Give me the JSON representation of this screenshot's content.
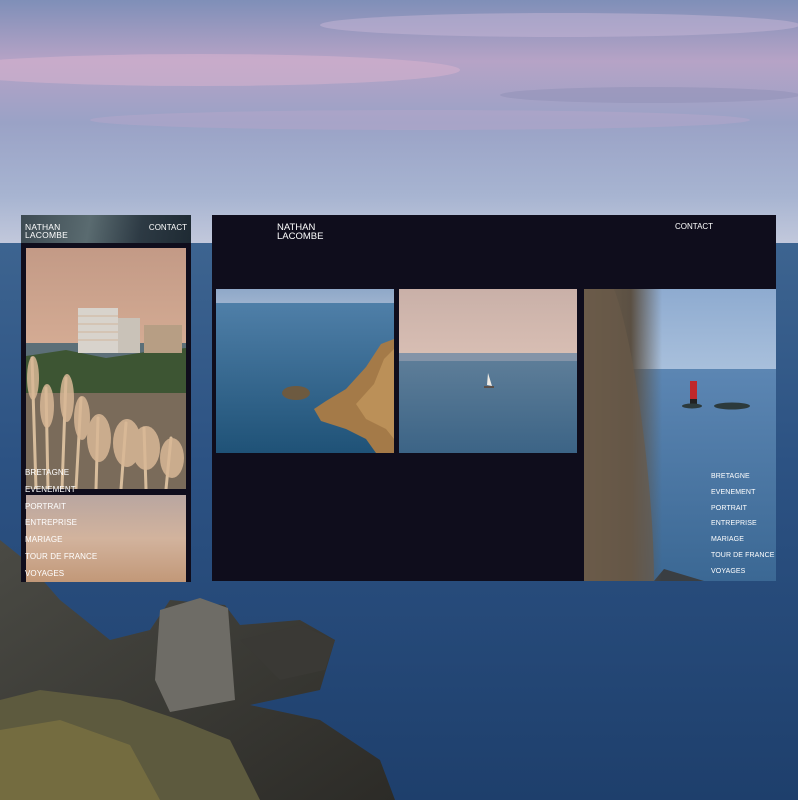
{
  "mobile": {
    "logo_line1": "NATHAN",
    "logo_line2": "LACOMBE",
    "contact": "CONTACT",
    "menu": [
      "BRETAGNE",
      "EVENEMENT",
      "PORTRAIT",
      "ENTREPRISE",
      "MARIAGE",
      "TOUR DE FRANCE",
      "VOYAGES"
    ]
  },
  "desktop": {
    "logo_line1": "NATHAN",
    "logo_line2": "LACOMBE",
    "contact": "CONTACT",
    "menu": [
      "BRETAGNE",
      "EVENEMENT",
      "PORTRAIT",
      "ENTREPRISE",
      "MARIAGE",
      "TOUR DE FRANCE",
      "VOYAGES"
    ]
  },
  "colors": {
    "panel_bg": "#0f0d1c",
    "sea": "#2a4e78",
    "sky_pink": "#c9a9c4"
  }
}
